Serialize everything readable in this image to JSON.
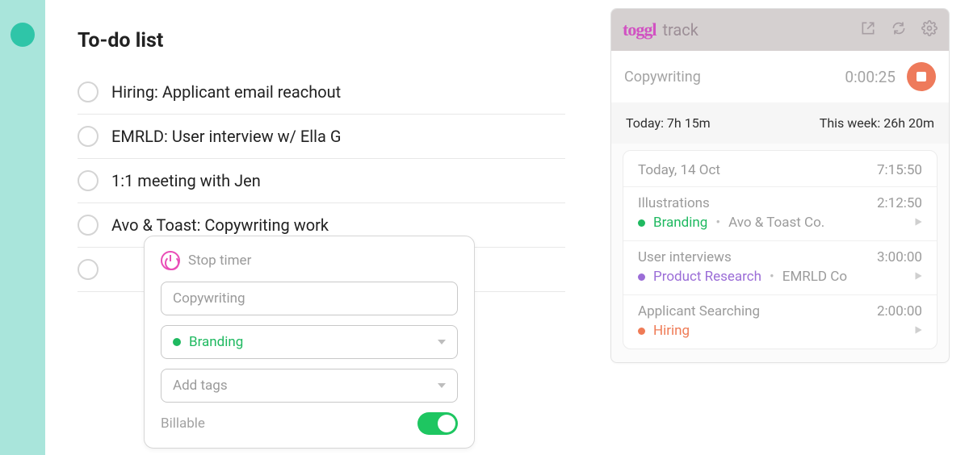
{
  "main": {
    "title": "To-do list",
    "todos": [
      {
        "label": "Hiring: Applicant email reachout"
      },
      {
        "label": "EMRLD: User interview w/ Ella G"
      },
      {
        "label": "1:1 meeting with Jen"
      },
      {
        "label": "Avo & Toast: Copywriting work"
      }
    ]
  },
  "popup": {
    "header": "Stop timer",
    "description": "Copywriting",
    "project": "Branding",
    "tags_placeholder": "Add tags",
    "billable_label": "Billable"
  },
  "panel": {
    "brand_toggl": "toggl",
    "brand_track": "track",
    "running": {
      "description": "Copywriting",
      "elapsed": "0:00:25"
    },
    "summary": {
      "today_label": "Today: 7h 15m",
      "week_label": "This week: 26h 20m"
    },
    "entries_header": {
      "date": "Today, 14 Oct",
      "total": "7:15:50"
    },
    "entries": [
      {
        "title": "Illustrations",
        "duration": "2:12:50",
        "project": "Branding",
        "project_color": "green",
        "client": "Avo & Toast Co."
      },
      {
        "title": "User interviews",
        "duration": "3:00:00",
        "project": "Product Research",
        "project_color": "purple",
        "client": "EMRLD Co"
      },
      {
        "title": "Applicant Searching",
        "duration": "2:00:00",
        "project": "Hiring",
        "project_color": "orange",
        "client": ""
      }
    ]
  }
}
